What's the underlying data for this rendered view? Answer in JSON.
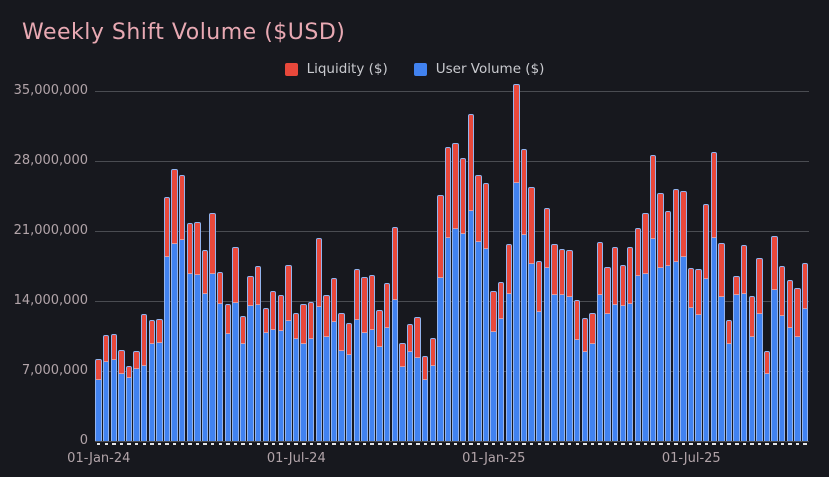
{
  "page": {
    "title": "Weekly Shift Volume ($USD)"
  },
  "legend": {
    "items": [
      {
        "label": "Liquidity ($)",
        "color": "#e8483b"
      },
      {
        "label": "User Volume ($)",
        "color": "#4182f0"
      }
    ]
  },
  "chart_data": {
    "type": "bar",
    "stacked": true,
    "title": "Weekly Shift Volume ($USD)",
    "subtitle": "",
    "xlabel": "",
    "ylabel": "",
    "values_unit": "USD millions",
    "weeks": 94,
    "x_axis": {
      "tick_labels": [
        "01-Jan-24",
        "01-Jul-24",
        "01-Jan-25",
        "01-Jul-25"
      ],
      "tick_week_indices": [
        0,
        26,
        52,
        78
      ],
      "cadence": "weekly"
    },
    "y_axis": {
      "tick_labels": [
        "0",
        "7,000,000",
        "14,000,000",
        "21,000,000",
        "28,000,000",
        "35,000,000"
      ],
      "tick_values_millions": [
        0,
        7,
        14,
        21,
        28,
        35
      ],
      "ylim_millions": [
        0,
        35.7
      ]
    },
    "series": [
      {
        "name": "User Volume ($)",
        "color": "#4182f0",
        "stack_order": "bottom",
        "values_millions": [
          6.2,
          8.0,
          8.2,
          6.8,
          6.4,
          7.3,
          7.6,
          9.8,
          9.9,
          18.5,
          19.8,
          20.2,
          16.8,
          16.7,
          14.8,
          16.8,
          13.8,
          10.8,
          13.9,
          9.8,
          13.6,
          13.7,
          10.9,
          11.2,
          11.1,
          12.1,
          10.3,
          9.8,
          10.3,
          13.5,
          10.5,
          12.0,
          9.1,
          8.7,
          12.2,
          10.9,
          11.2,
          9.5,
          11.4,
          14.2,
          7.5,
          9.0,
          8.4,
          6.2,
          7.6,
          16.4,
          20.4,
          21.3,
          20.8,
          23.1,
          20.0,
          19.3,
          11.0,
          12.3,
          14.8,
          25.9,
          20.7,
          17.8,
          13.0,
          17.4,
          14.7,
          14.7,
          14.5,
          10.2,
          9.0,
          9.8,
          14.7,
          12.8,
          13.7,
          13.6,
          13.8,
          16.6,
          16.8,
          20.3,
          17.4,
          17.6,
          18.0,
          18.5,
          13.4,
          12.7,
          16.3,
          20.4,
          14.5,
          9.8,
          14.7,
          14.8,
          10.5,
          12.8,
          6.8,
          15.2,
          12.6,
          11.4,
          10.5,
          13.3
        ]
      },
      {
        "name": "Liquidity ($)",
        "color": "#e8483b",
        "stack_order": "top",
        "values_millions": [
          2.0,
          2.6,
          2.5,
          2.3,
          1.1,
          1.7,
          5.1,
          2.3,
          2.3,
          5.9,
          7.4,
          6.4,
          5.0,
          5.2,
          4.3,
          6.0,
          3.1,
          2.9,
          5.5,
          2.7,
          2.9,
          3.8,
          2.4,
          3.8,
          3.5,
          5.5,
          2.5,
          3.9,
          3.6,
          6.8,
          4.1,
          4.3,
          3.7,
          3.1,
          5.0,
          5.5,
          5.4,
          3.6,
          4.4,
          7.2,
          2.3,
          2.7,
          4.0,
          2.3,
          2.7,
          8.2,
          9.0,
          8.5,
          7.5,
          9.6,
          6.6,
          6.5,
          4.0,
          3.6,
          4.9,
          9.8,
          8.5,
          7.6,
          5.0,
          5.9,
          5.0,
          4.5,
          4.6,
          3.9,
          3.3,
          3.0,
          5.2,
          4.6,
          5.7,
          4.0,
          5.6,
          4.7,
          6.0,
          8.3,
          7.4,
          5.4,
          7.2,
          6.5,
          3.9,
          4.5,
          7.4,
          8.5,
          5.3,
          2.3,
          1.8,
          4.8,
          4.0,
          5.5,
          2.2,
          5.3,
          4.9,
          4.7,
          4.8,
          4.5
        ]
      }
    ],
    "layout_hints": {
      "grid": "horizontal",
      "legend_position": "top-center",
      "background_color": "#17181e",
      "gridline_color": "#4a4c52",
      "title_color": "#e8a9b3",
      "axis_label_color": "#b2a4a9",
      "bar_outline_color": "rgba(230,230,235,0.5)",
      "axis_dash_color": "#e3e3e6"
    }
  }
}
